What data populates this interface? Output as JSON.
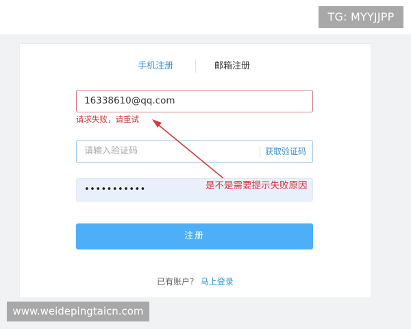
{
  "badge": {
    "text": "TG: MYYJJPP"
  },
  "tabs": [
    {
      "label": "手机注册",
      "active": true
    },
    {
      "label": "邮箱注册",
      "active": false
    }
  ],
  "email_field": {
    "value": "16338610@qq.com"
  },
  "error": {
    "message": "请求失败，请重试"
  },
  "code_field": {
    "placeholder": "请输入验证码",
    "get_code_label": "获取验证码"
  },
  "password_field": {
    "masked_value": "•••••••••••"
  },
  "annotation": {
    "text": "是不是需要提示失败原因"
  },
  "register_button": {
    "label": "注册"
  },
  "login_prompt": {
    "text": "已有账户？",
    "link": "马上登录"
  },
  "watermark": {
    "text": "www.weidepingtaicn.com"
  },
  "colors": {
    "accent_blue": "#3a92d2",
    "button_blue": "#4daff7",
    "error_red": "#cc3333",
    "annotation_red": "#d8343c"
  }
}
